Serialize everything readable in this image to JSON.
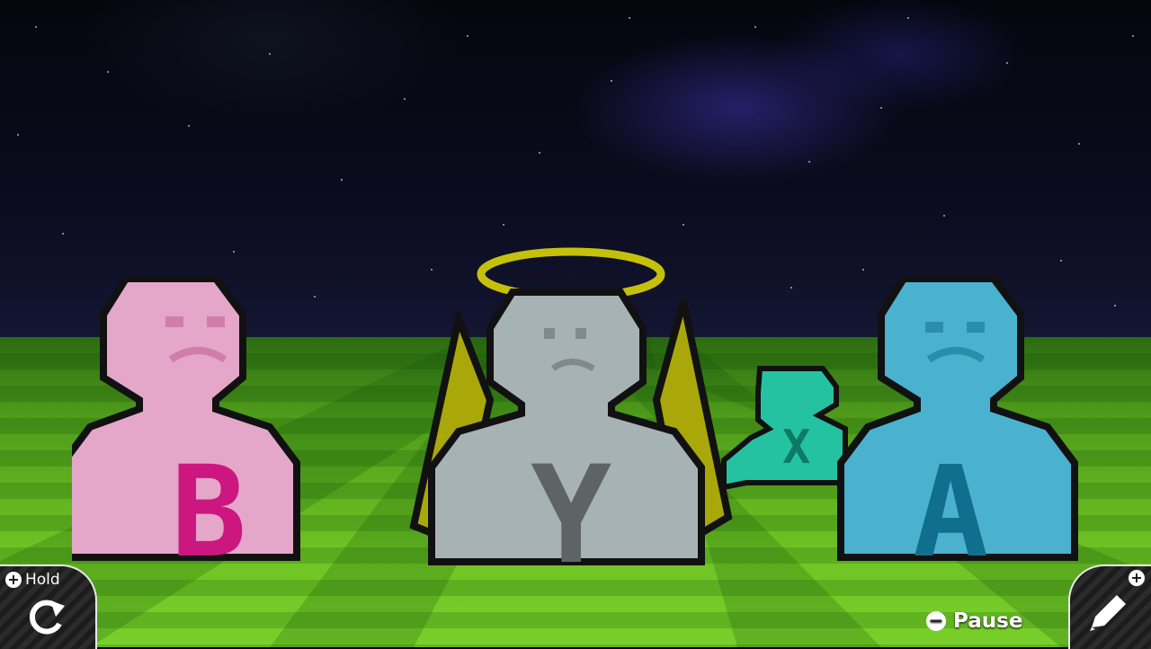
{
  "hud": {
    "hold_label": "Hold",
    "hold_plus": "+",
    "pause_label": "Pause",
    "pause_minus": "−",
    "edit_plus": "+"
  },
  "characters": [
    {
      "letter": "B",
      "color": "#e4a7c9",
      "accent": "#cc1780"
    },
    {
      "letter": "Y",
      "color": "#a7b2b4",
      "accent": "#5e6466"
    },
    {
      "letter": "X",
      "color": "#25c2a2",
      "accent": "#0e7a64"
    },
    {
      "letter": "A",
      "color": "#4ab2cf",
      "accent": "#0f6f8c"
    }
  ],
  "icons": [
    "rotate-icon",
    "pencil-icon",
    "plus-icon",
    "minus-icon"
  ]
}
